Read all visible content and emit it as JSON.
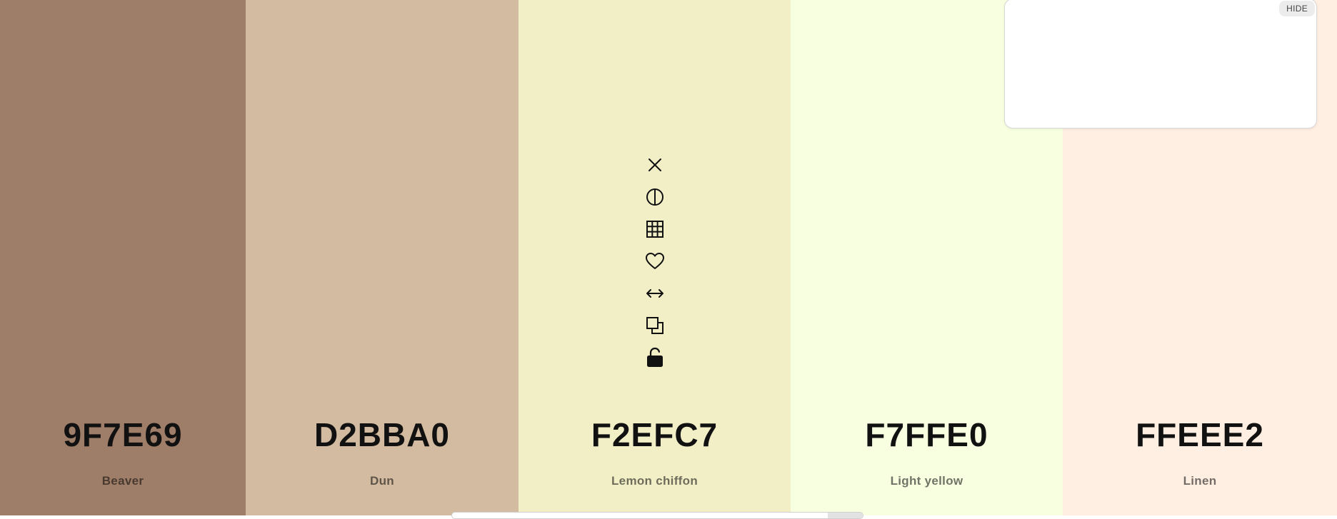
{
  "swatches": [
    {
      "hex": "9F7E69",
      "name": "Beaver",
      "color": "#9F7E69"
    },
    {
      "hex": "D2BBA0",
      "name": "Dun",
      "color": "#D2BBA0"
    },
    {
      "hex": "F2EFC7",
      "name": "Lemon chiffon",
      "color": "#F2EFC7"
    },
    {
      "hex": "F7FFE0",
      "name": "Light yellow",
      "color": "#F7FFE0"
    },
    {
      "hex": "FFEEE2",
      "name": "Linen",
      "color": "#FFEEE2"
    }
  ],
  "tools": [
    {
      "icon": "close-icon"
    },
    {
      "icon": "contrast-icon"
    },
    {
      "icon": "grid-icon"
    },
    {
      "icon": "heart-icon"
    },
    {
      "icon": "drag-horizontal-icon"
    },
    {
      "icon": "copy-icon"
    },
    {
      "icon": "unlock-icon"
    }
  ],
  "panel": {
    "hide_label": "HIDE"
  }
}
